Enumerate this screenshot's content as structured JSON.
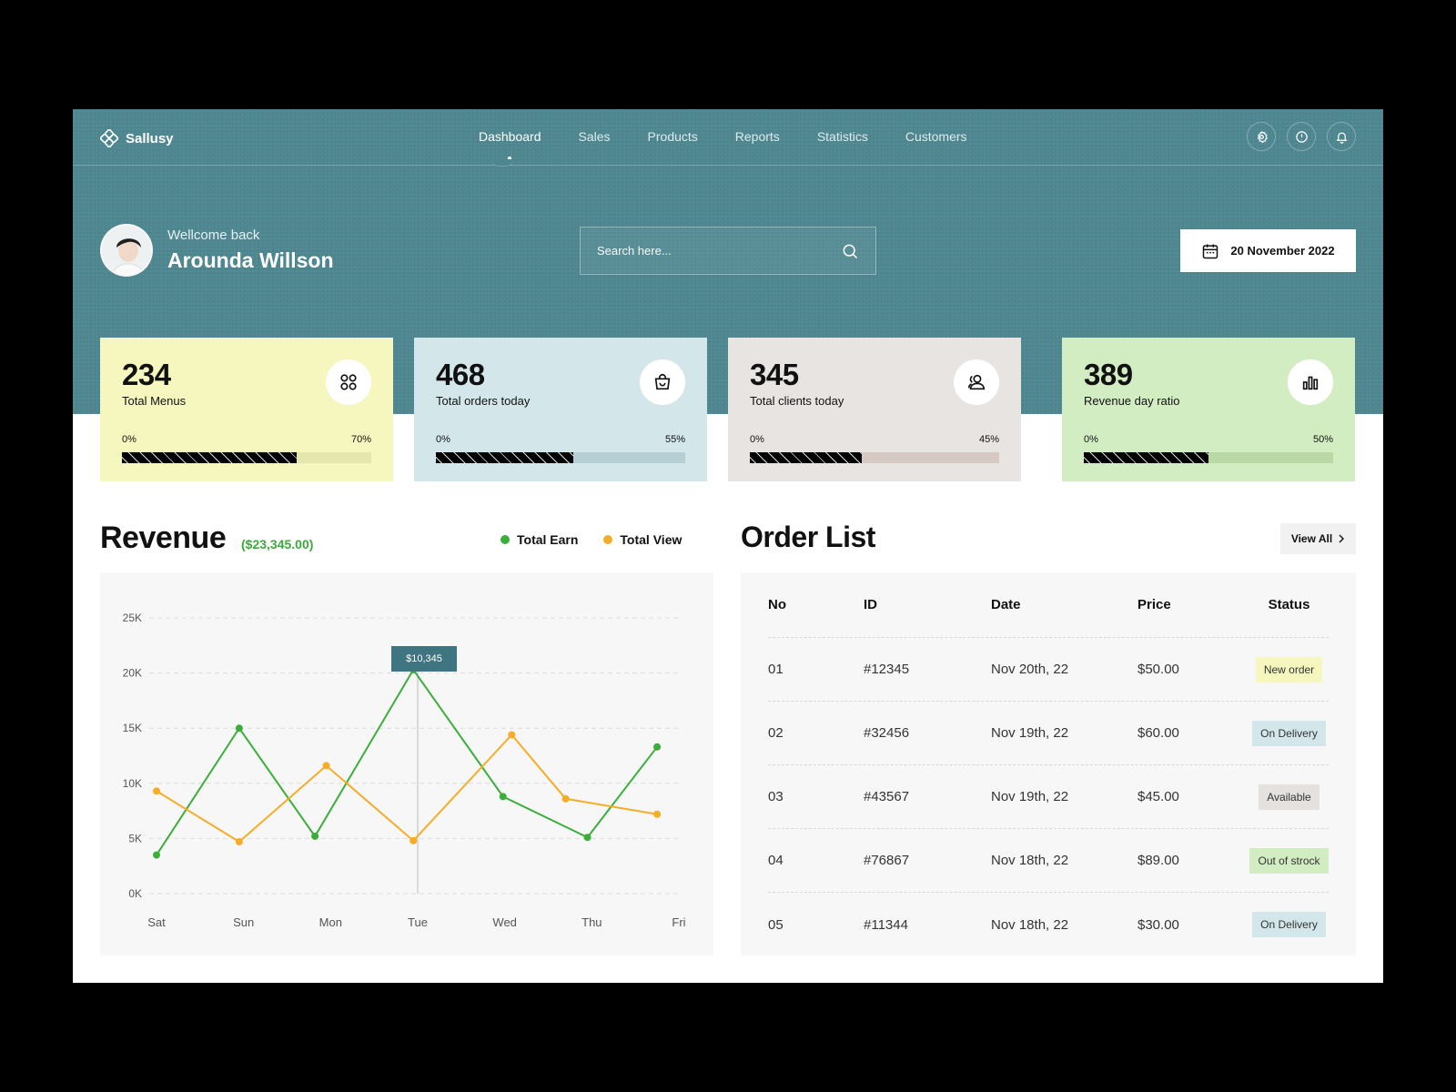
{
  "brand": {
    "name": "Sallusy"
  },
  "nav": {
    "items": [
      {
        "label": "Dashboard",
        "active": true
      },
      {
        "label": "Sales"
      },
      {
        "label": "Products"
      },
      {
        "label": "Reports"
      },
      {
        "label": "Statistics"
      },
      {
        "label": "Customers"
      }
    ],
    "icons": [
      "gear-icon",
      "alert-icon",
      "bell-icon"
    ]
  },
  "welcome": {
    "subtitle": "Wellcome back",
    "name": "Arounda Willson"
  },
  "search": {
    "placeholder": "Search here..."
  },
  "date": {
    "label": "20 November 2022"
  },
  "cards": [
    {
      "value": "234",
      "label": "Total Menus",
      "min": "0%",
      "max": "70%",
      "progress": 0.7,
      "bg": "#f6f7be",
      "track": "#e4e6ad",
      "icon": "grid-icon"
    },
    {
      "value": "468",
      "label": "Total orders today",
      "min": "0%",
      "max": "55%",
      "progress": 0.55,
      "bg": "#d3e6ea",
      "track": "#b5cfd4",
      "icon": "shopping-bag-icon"
    },
    {
      "value": "345",
      "label": "Total clients today",
      "min": "0%",
      "max": "45%",
      "progress": 0.45,
      "bg": "#e8e4e2",
      "track": "#d6c8c3",
      "icon": "users-icon"
    },
    {
      "value": "389",
      "label": "Revenue day ratio",
      "min": "0%",
      "max": "50%",
      "progress": 0.5,
      "bg": "#d3edc3",
      "track": "#b9d8a6",
      "icon": "bar-chart-icon"
    }
  ],
  "revenue": {
    "title": "Revenue",
    "total": "($23,345.00)",
    "legend": [
      {
        "label": "Total Earn",
        "color": "#3aae3a"
      },
      {
        "label": "Total View",
        "color": "#f5ad27"
      }
    ],
    "tooltip": "$10,345"
  },
  "chart_data": {
    "type": "line",
    "categories": [
      "Sat",
      "Sun",
      "Mon",
      "Tue",
      "Wed",
      "Thu",
      "Fri"
    ],
    "y_ticks": [
      "0K",
      "5K",
      "10K",
      "15K",
      "20K",
      "25K"
    ],
    "ylim": [
      0,
      25000
    ],
    "grid": true,
    "series": [
      {
        "name": "Total Earn",
        "color": "#3aae3a",
        "x": [
          0,
          0.95,
          1.82,
          2.95,
          3.98,
          4.95,
          5.75
        ],
        "values": [
          3500,
          15000,
          5200,
          20300,
          8800,
          5100,
          13300
        ]
      },
      {
        "name": "Total View",
        "color": "#f5ad27",
        "x": [
          0,
          0.95,
          1.95,
          2.95,
          4.08,
          4.7,
          5.75
        ],
        "values": [
          9300,
          4700,
          11600,
          4800,
          14400,
          8600,
          7200
        ]
      }
    ],
    "highlight": {
      "category": "Tue",
      "label": "$10,345"
    }
  },
  "orders": {
    "title": "Order List",
    "view_all": "View All",
    "columns": [
      "No",
      "ID",
      "Date",
      "Price",
      "Status"
    ],
    "rows": [
      {
        "no": "01",
        "id": "#12345",
        "date": "Nov 20th, 22",
        "price": "$50.00",
        "status": "New order",
        "status_bg": "#f6f7be"
      },
      {
        "no": "02",
        "id": "#32456",
        "date": "Nov 19th, 22",
        "price": "$60.00",
        "status": "On Delivery",
        "status_bg": "#d3e6ea"
      },
      {
        "no": "03",
        "id": "#43567",
        "date": "Nov 19th, 22",
        "price": "$45.00",
        "status": "Available",
        "status_bg": "#e4e1df"
      },
      {
        "no": "04",
        "id": "#76867",
        "date": "Nov 18th, 22",
        "price": "$89.00",
        "status": "Out of strock",
        "status_bg": "#d3edc3"
      },
      {
        "no": "05",
        "id": "#11344",
        "date": "Nov 18th, 22",
        "price": "$30.00",
        "status": "On Delivery",
        "status_bg": "#d3e6ea"
      }
    ]
  }
}
